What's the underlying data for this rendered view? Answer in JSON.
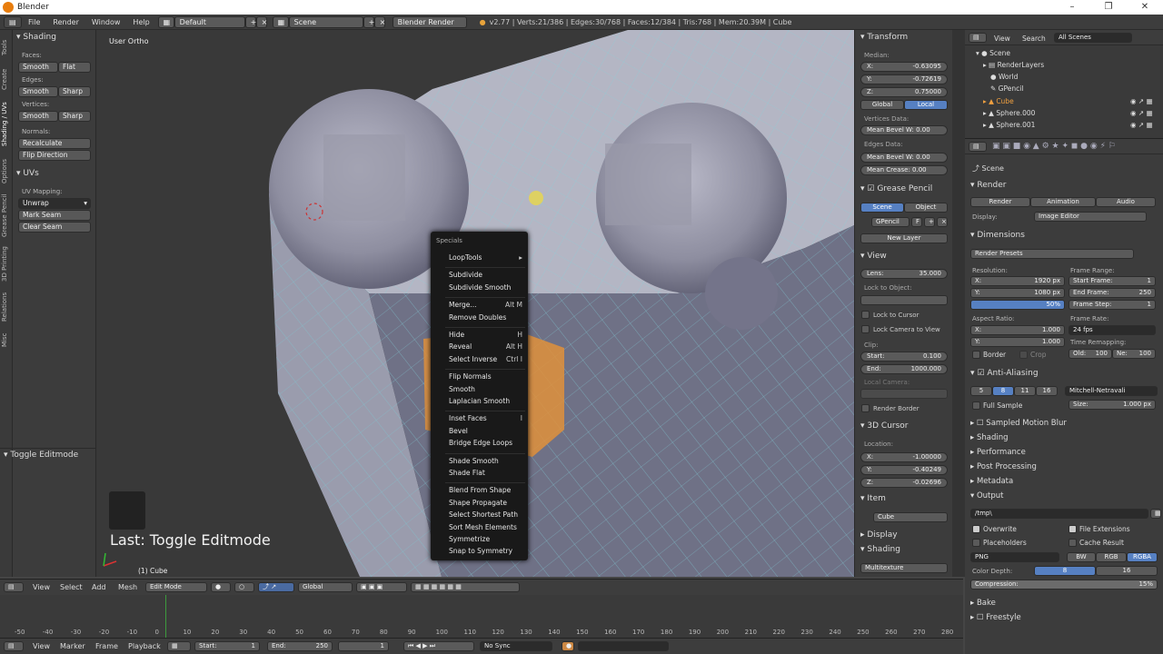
{
  "window": {
    "title": "Blender"
  },
  "infobar": {
    "menus": [
      "File",
      "Render",
      "Window",
      "Help"
    ],
    "layout": "Default",
    "scene": "Scene",
    "engine": "Blender Render",
    "stats": "v2.77 | Verts:21/386 | Edges:30/768 | Faces:12/384 | Tris:768 | Mem:20.39M | Cube"
  },
  "shelf_tabs": [
    "Tools",
    "Create",
    "Shading / UVs",
    "Options",
    "Grease Pencil",
    "3D Printing",
    "Relations",
    "Misc"
  ],
  "toolshelf": {
    "shading_title": "Shading",
    "faces_label": "Faces:",
    "edges_label": "Edges:",
    "vertices_label": "Vertices:",
    "smooth": "Smooth",
    "flat": "Flat",
    "sharp": "Sharp",
    "normals_label": "Normals:",
    "recalculate": "Recalculate",
    "flip_direction": "Flip Direction",
    "uvs_title": "UVs",
    "uv_mapping_label": "UV Mapping:",
    "unwrap": "Unwrap",
    "mark_seam": "Mark Seam",
    "clear_seam": "Clear Seam",
    "operator_title": "Toggle Editmode"
  },
  "viewport": {
    "view_label": "User Ortho",
    "last_op": "Last: Toggle Editmode",
    "object_label": "(1) Cube"
  },
  "specials": {
    "title": "Specials",
    "groups": [
      [
        {
          "label": "LoopTools",
          "key": "▸"
        }
      ],
      [
        {
          "label": "Subdivide",
          "key": ""
        },
        {
          "label": "Subdivide Smooth",
          "key": ""
        }
      ],
      [
        {
          "label": "Merge...",
          "key": "Alt M"
        },
        {
          "label": "Remove Doubles",
          "key": ""
        }
      ],
      [
        {
          "label": "Hide",
          "key": "H"
        },
        {
          "label": "Reveal",
          "key": "Alt H"
        },
        {
          "label": "Select Inverse",
          "key": "Ctrl I"
        }
      ],
      [
        {
          "label": "Flip Normals",
          "key": ""
        },
        {
          "label": "Smooth",
          "key": ""
        },
        {
          "label": "Laplacian Smooth",
          "key": ""
        }
      ],
      [
        {
          "label": "Inset Faces",
          "key": "I"
        },
        {
          "label": "Bevel",
          "key": ""
        },
        {
          "label": "Bridge Edge Loops",
          "key": ""
        }
      ],
      [
        {
          "label": "Shade Smooth",
          "key": ""
        },
        {
          "label": "Shade Flat",
          "key": ""
        }
      ],
      [
        {
          "label": "Blend From Shape",
          "key": ""
        },
        {
          "label": "Shape Propagate",
          "key": ""
        },
        {
          "label": "Select Shortest Path",
          "key": ""
        },
        {
          "label": "Sort Mesh Elements",
          "key": ""
        },
        {
          "label": "Symmetrize",
          "key": ""
        },
        {
          "label": "Snap to Symmetry",
          "key": ""
        }
      ]
    ]
  },
  "npanel": {
    "transform_title": "Transform",
    "median_label": "Median:",
    "x": "-0.63095",
    "y": "-0.72619",
    "z": "0.75000",
    "global": "Global",
    "local": "Local",
    "vertices_data": "Vertices Data:",
    "mean_bevel_w": "Mean Bevel W: 0.00",
    "edges_data": "Edges Data:",
    "mean_bevel_w2": "Mean Bevel W: 0.00",
    "mean_crease": "Mean Crease: 0.00",
    "grease_title": "Grease Pencil",
    "scene_btn": "Scene",
    "object_btn": "Object",
    "gpencil": "GPencil",
    "gpencil_f": "F",
    "new_layer": "New Layer",
    "view_title": "View",
    "lens_label": "Lens:",
    "lens": "35.000",
    "lock_to_object": "Lock to Object:",
    "lock_to_cursor": "Lock to Cursor",
    "lock_camera": "Lock Camera to View",
    "clip_label": "Clip:",
    "start_label": "Start:",
    "start": "0.100",
    "end_label": "End:",
    "end": "1000.000",
    "local_camera": "Local Camera:",
    "render_border": "Render Border",
    "cursor_title": "3D Cursor",
    "location_label": "Location:",
    "cx": "-1.00000",
    "cy": "-0.40249",
    "cz": "-0.02696",
    "item_title": "Item",
    "item_name": "Cube",
    "display_title": "Display",
    "shading_title": "Shading",
    "multitexture": "Multitexture"
  },
  "outliner": {
    "view": "View",
    "search": "Search",
    "filter": "All Scenes",
    "items": [
      "Scene",
      "RenderLayers",
      "World",
      "GPencil",
      "Cube",
      "Sphere.000",
      "Sphere.001"
    ]
  },
  "props": {
    "scene": "Scene",
    "render_title": "Render",
    "render_btn": "Render",
    "animation_btn": "Animation",
    "audio_btn": "Audio",
    "display_label": "Display:",
    "display_value": "Image Editor",
    "dimensions_title": "Dimensions",
    "render_presets": "Render Presets",
    "resolution_label": "Resolution:",
    "res_x": "1920 px",
    "res_y": "1080 px",
    "res_pct": "50%",
    "frame_range_label": "Frame Range:",
    "start_frame": "1",
    "end_frame": "250",
    "frame_step": "1",
    "aspect_label": "Aspect Ratio:",
    "aspect_x": "1.000",
    "aspect_y": "1.000",
    "frame_rate_label": "Frame Rate:",
    "fps": "24 fps",
    "time_remap_label": "Time Remapping:",
    "old": "100",
    "new": "100",
    "border": "Border",
    "crop": "Crop",
    "aa_title": "Anti-Aliasing",
    "aa_samples": [
      "5",
      "8",
      "11",
      "16"
    ],
    "aa_filter": "Mitchell-Netravali",
    "full_sample": "Full Sample",
    "size_label": "Size:",
    "size": "1.000 px",
    "sections": [
      "Sampled Motion Blur",
      "Shading",
      "Performance",
      "Post Processing",
      "Metadata"
    ],
    "output_title": "Output",
    "output_path": "/tmp\\",
    "overwrite": "Overwrite",
    "file_extensions": "File Extensions",
    "placeholders": "Placeholders",
    "cache_result": "Cache Result",
    "format": "PNG",
    "bw": "BW",
    "rgb": "RGB",
    "rgba": "RGBA",
    "color_depth_label": "Color Depth:",
    "depth8": "8",
    "depth16": "16",
    "compression_label": "Compression:",
    "compression": "15%",
    "bake_title": "Bake",
    "freestyle_title": "Freestyle"
  },
  "vheader": {
    "view": "View",
    "select": "Select",
    "add": "Add",
    "mesh": "Mesh",
    "mode": "Edit Mode",
    "orientation": "Global"
  },
  "timeline": {
    "ticks": [
      "-50",
      "-40",
      "-30",
      "-20",
      "-10",
      "0",
      "10",
      "20",
      "30",
      "40",
      "50",
      "60",
      "70",
      "80",
      "90",
      "100",
      "110",
      "120",
      "130",
      "140",
      "150",
      "160",
      "170",
      "180",
      "190",
      "200",
      "210",
      "220",
      "230",
      "240",
      "250",
      "260",
      "270",
      "280"
    ]
  },
  "tlheader": {
    "view": "View",
    "marker": "Marker",
    "frame": "Frame",
    "playback": "Playback",
    "start_label": "Start:",
    "start": "1",
    "end_label": "End:",
    "end": "250",
    "current": "1",
    "sync": "No Sync"
  }
}
